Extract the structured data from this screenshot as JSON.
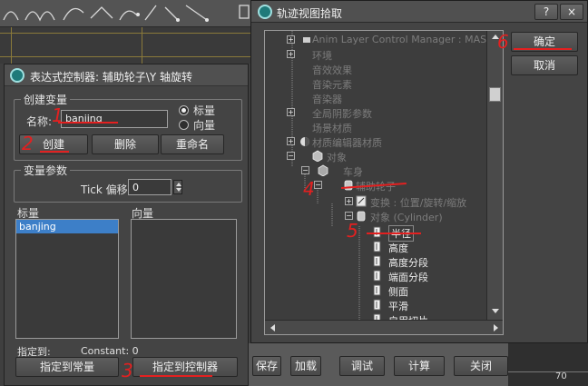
{
  "background": {
    "timeline_number": "70"
  },
  "expr_dialog": {
    "title": "表达式控制器: 辅助轮子\\Y 轴旋转",
    "create_group": {
      "label": "创建变量",
      "name_label": "名称:",
      "name_value": "banjing",
      "radio_scalar": "标量",
      "radio_vector": "向量",
      "scalar_selected": true,
      "create_button": "创建",
      "delete_button": "删除",
      "rename_button": "重命名"
    },
    "var_params": {
      "label": "变量参数",
      "tick_label": "Tick 偏移:",
      "tick_value": "0"
    },
    "scalar_list": {
      "header": "标量",
      "items": [
        "banjing"
      ]
    },
    "vector_list": {
      "header": "向量",
      "items": []
    },
    "assign_label": "指定到:",
    "constant_label": "Constant: 0",
    "assign_constant_button": "指定到常量",
    "assign_controller_button": "指定到控制器",
    "save_button": "保存",
    "load_button": "加载",
    "debug_button": "调试",
    "evaluate_button": "计算",
    "close_button": "关闭"
  },
  "trackview_dialog": {
    "title": "轨迹视图拾取",
    "help_button": "?",
    "close_button": "×",
    "ok_button": "确定",
    "cancel_button": "取消",
    "tree": [
      {
        "label": "Anim Layer Control Manager : MASTER",
        "dim": true
      },
      {
        "label": "环境",
        "dim": true
      },
      {
        "label": "音效效果",
        "dim": true
      },
      {
        "label": "音染元素",
        "dim": true
      },
      {
        "label": "音染器",
        "dim": true
      },
      {
        "label": "全局阴影参数",
        "dim": true
      },
      {
        "label": "场景材质",
        "dim": true
      },
      {
        "label": "材质编辑器材质",
        "dim": true
      },
      {
        "label": "对象",
        "dim": true
      },
      {
        "label": "车身",
        "dim": true
      },
      {
        "label": "辅助轮子",
        "dim": true
      },
      {
        "label": "变换 : 位置/旋转/缩放",
        "dim": true
      },
      {
        "label": "对象 (Cylinder)",
        "dim": true
      },
      {
        "label": "半径",
        "dim": false,
        "selected": true
      },
      {
        "label": "高度",
        "dim": false
      },
      {
        "label": "高度分段",
        "dim": false
      },
      {
        "label": "端面分段",
        "dim": false
      },
      {
        "label": "侧面",
        "dim": false
      },
      {
        "label": "平滑",
        "dim": false
      },
      {
        "label": "启用切片",
        "dim": false
      }
    ]
  },
  "annotations": {
    "n1": "1",
    "n2": "2",
    "n3": "3",
    "n4": "4",
    "n5": "5",
    "n6": "6"
  },
  "colors": {
    "accent": "#3d7fc8",
    "annotation_red": "#e32020"
  }
}
